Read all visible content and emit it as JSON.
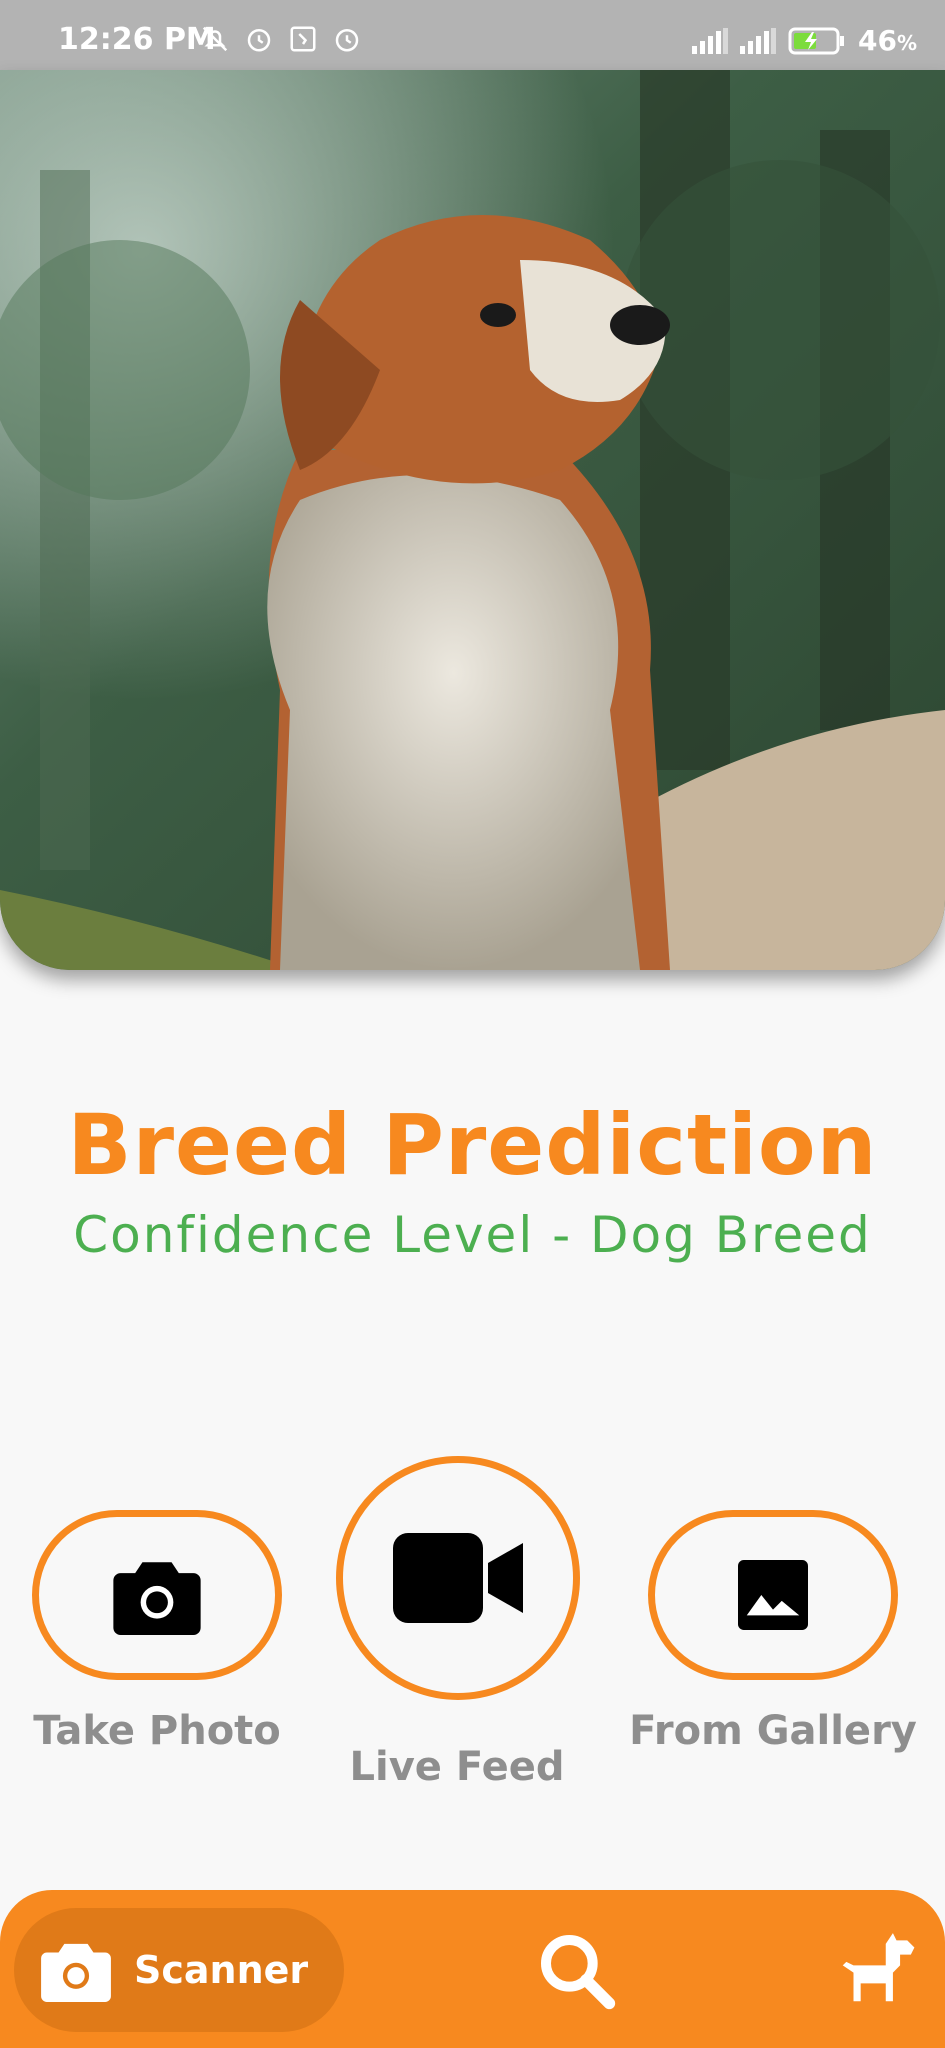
{
  "status_bar": {
    "time": "12:26 PM",
    "battery": "46",
    "battery_unit": "%",
    "left_icons": [
      "notifications-off-icon",
      "alarm-icon",
      "app-notification-icon",
      "alarm-icon"
    ],
    "right_icons": [
      "signal-icon",
      "signal-icon",
      "battery-charging-icon"
    ]
  },
  "hero": {
    "image": "dog-photo",
    "description_icon": "dog-photo"
  },
  "title": "Breed Prediction",
  "subtitle": "Confidence Level - Dog Breed",
  "actions": {
    "take_photo": {
      "label": "Take Photo",
      "icon": "camera-icon"
    },
    "live_feed": {
      "label": "Live Feed",
      "icon": "video-camera-icon"
    },
    "from_gallery": {
      "label": "From Gallery",
      "icon": "image-icon"
    }
  },
  "bottom_nav": {
    "items": [
      {
        "label": "Scanner",
        "icon": "camera-icon",
        "active": true
      },
      {
        "label": "",
        "icon": "search-icon",
        "active": false
      },
      {
        "label": "",
        "icon": "dog-icon",
        "active": false
      }
    ]
  },
  "colors": {
    "accent": "#f7891f",
    "accent_dark": "#e07a18",
    "subtitle": "#4caf50",
    "label": "#8e8e8e",
    "status_bar": "#b3b3b3"
  }
}
